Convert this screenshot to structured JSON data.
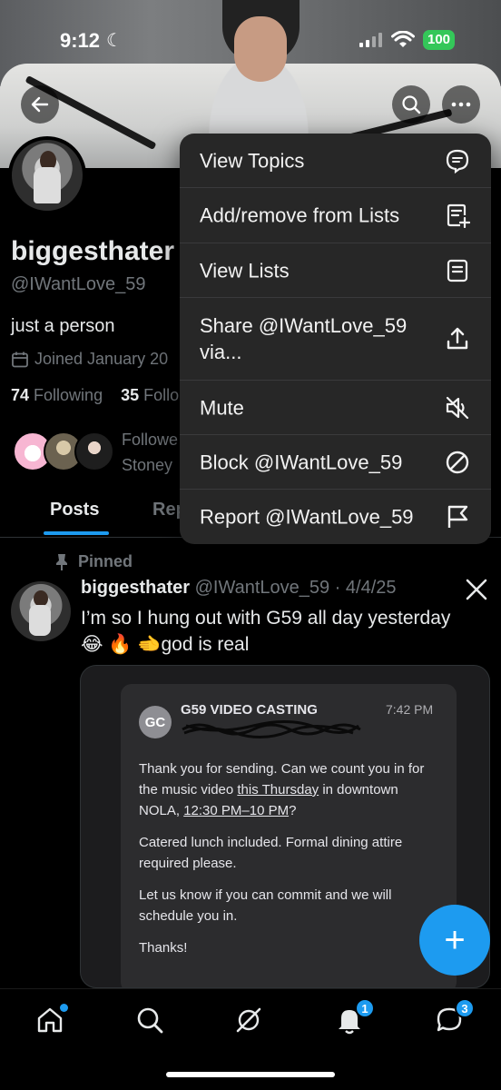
{
  "status_bar": {
    "time": "9:12",
    "battery": "100"
  },
  "profile": {
    "name": "biggesthater",
    "handle": "@IWantLove_59",
    "bio": "just a person",
    "joined": "Joined January 20",
    "following_count": "74",
    "following_label": "Following",
    "followers_count": "35",
    "followers_label": "Follo",
    "followed_by_line1": "Followe",
    "followed_by_line2": "Stoney"
  },
  "tabs": [
    {
      "label": "Posts"
    },
    {
      "label": "Rep"
    }
  ],
  "menu": {
    "items": [
      {
        "label": "View Topics",
        "icon": "topics-icon"
      },
      {
        "label": "Add/remove from Lists",
        "icon": "list-add-icon"
      },
      {
        "label": "View Lists",
        "icon": "lists-icon"
      },
      {
        "label": "Share @IWantLove_59 via...",
        "icon": "share-icon"
      },
      {
        "label": "Mute",
        "icon": "mute-icon"
      },
      {
        "label": "Block @IWantLove_59",
        "icon": "block-icon"
      },
      {
        "label": "Report @IWantLove_59",
        "icon": "flag-icon"
      }
    ]
  },
  "post": {
    "pinned_label": "Pinned",
    "author_name": "biggesthater",
    "author_handle_date": "@IWantLove_59 · 4/4/25",
    "text_line1": "I’m so I hung out with G59 all day yesterday",
    "text_line2": "😂 🔥 🫲god is real",
    "media": {
      "sender_initials": "GC",
      "sender_name": "G59 VIDEO CASTING",
      "time": "7:42 PM",
      "body_p1_a": "Thank you for sending. Can we count you in for the music video ",
      "body_p1_u1": "this Thursday",
      "body_p1_b": " in downtown NOLA, ",
      "body_p1_u2": "12:30 PM–10 PM",
      "body_p1_c": "?",
      "body_p2": "Catered lunch included. Formal dining attire required please.",
      "body_p3": "Let us know if you can commit and we will schedule you in.",
      "body_p4": "Thanks!"
    }
  },
  "fab": {
    "label": "+"
  },
  "bottom_nav": {
    "notifications_badge": "1",
    "messages_badge": "3"
  },
  "colors": {
    "accent": "#1d9bf0",
    "battery": "#34c759",
    "menu_bg": "#272727"
  }
}
